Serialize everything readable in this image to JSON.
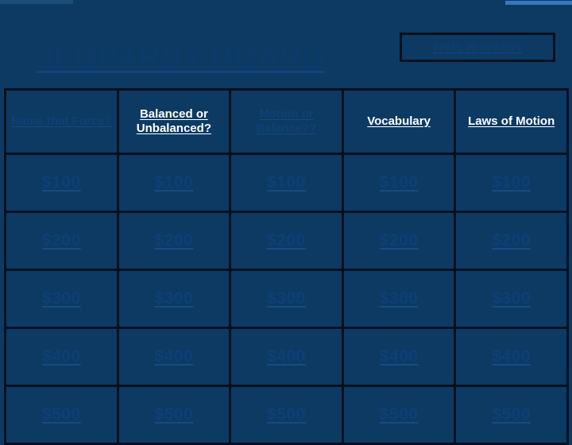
{
  "board": {
    "title": "JEOPARDY BOARD",
    "final_jeopardy_label": "FINAL JEOPARDY",
    "columns": [
      {
        "label": "Name that Force?",
        "style": "dim"
      },
      {
        "label": "Balanced or Unbalanced?",
        "style": "bright"
      },
      {
        "label": "Motion or Balance??",
        "style": "dim"
      },
      {
        "label": "Vocabulary",
        "style": "bright"
      },
      {
        "label": "Laws of Motion",
        "style": "bright"
      }
    ],
    "rows": [
      {
        "values": [
          "$100",
          "$100",
          "$100",
          "$100",
          "$100"
        ]
      },
      {
        "values": [
          "$200",
          "$200",
          "$200",
          "$200",
          "$200"
        ]
      },
      {
        "values": [
          "$300",
          "$300",
          "$300",
          "$300",
          "$300"
        ]
      },
      {
        "values": [
          "$400",
          "$400",
          "$400",
          "$400",
          "$400"
        ]
      },
      {
        "values": [
          "$500",
          "$500",
          "$500",
          "$500",
          "$500"
        ]
      }
    ]
  },
  "colors": {
    "background": "#0d3a63",
    "grid_line": "#04101f",
    "bright_text": "#ffffff",
    "dim_text": "#0e3f70",
    "value_text": "#0d4077",
    "artifact_left": "#1b4d79",
    "artifact_right": "#3a78bd"
  }
}
